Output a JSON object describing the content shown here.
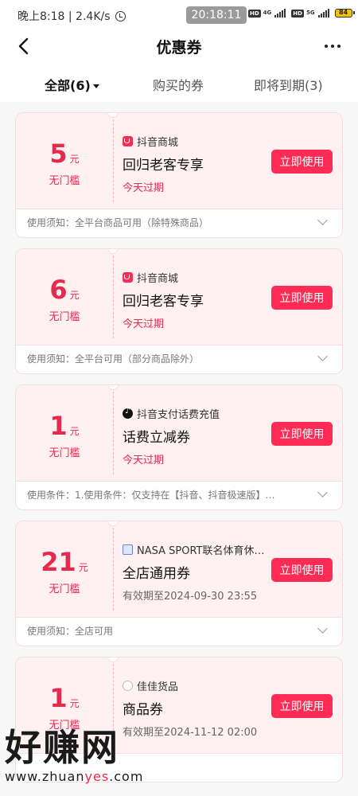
{
  "status_bar": {
    "left_text": "晚上8:18 | 2.4K/s",
    "time_pill": "20:18:11",
    "hd1": "HD",
    "net1": "4G",
    "hd2": "HD",
    "net2": "5G",
    "battery": "84",
    "icons": [
      "alarm-icon",
      "signal-icon",
      "battery-icon"
    ]
  },
  "navbar": {
    "title": "优惠券",
    "back_icon": "back-chevron-icon",
    "more_icon": "more-dots-icon"
  },
  "tabs": [
    {
      "label": "全部(6)",
      "active": true
    },
    {
      "label": "购买的券",
      "active": false
    },
    {
      "label": "即将到期(3)",
      "active": false
    }
  ],
  "coupons": [
    {
      "amount": "5",
      "unit": "元",
      "threshold": "无门槛",
      "shop": "抖音商城",
      "shop_icon": "douyin-mall-icon",
      "name": "回归老客专享",
      "expiry": "今天过期",
      "button": "立即使用",
      "notes": "使用须知：全平台商品可用（除特殊商品）"
    },
    {
      "amount": "6",
      "unit": "元",
      "threshold": "无门槛",
      "shop": "抖音商城",
      "shop_icon": "douyin-mall-icon",
      "name": "回归老客专享",
      "expiry": "今天过期",
      "button": "立即使用",
      "notes": "使用须知：全平台可用（部分商品除外）"
    },
    {
      "amount": "1",
      "unit": "元",
      "threshold": "无门槛",
      "shop": "抖音支付话费充值",
      "shop_icon": "tiktok-icon",
      "name": "话费立减券",
      "expiry": "今天过期",
      "button": "立即使用",
      "notes": "使用条件：1.使用条件：仅支持在【抖音、抖音极速版】…"
    },
    {
      "amount": "21",
      "unit": "元",
      "threshold": "无门槛",
      "shop": "NASA SPORT联名体育休…",
      "shop_icon": "nasa-sport-icon",
      "name": "全店通用券",
      "expiry": "有效期至2024-09-30 23:55",
      "button": "立即使用",
      "notes": "使用须知：全店可用"
    },
    {
      "amount": "1",
      "unit": "元",
      "threshold": "无门槛",
      "shop": "佳佳货品",
      "shop_icon": "jiajia-shop-icon",
      "name": "商品券",
      "expiry": "有效期至2024-11-12 02:00",
      "button": "立即使用",
      "notes": ""
    }
  ],
  "watermark": {
    "big": "好赚网",
    "small_a": "www.zhuan",
    "small_b": "yes",
    "small_c": ".com"
  },
  "colors": {
    "accent": "#fe2c55",
    "price": "#e62a4d",
    "coupon_bg": "#fff0f2"
  }
}
